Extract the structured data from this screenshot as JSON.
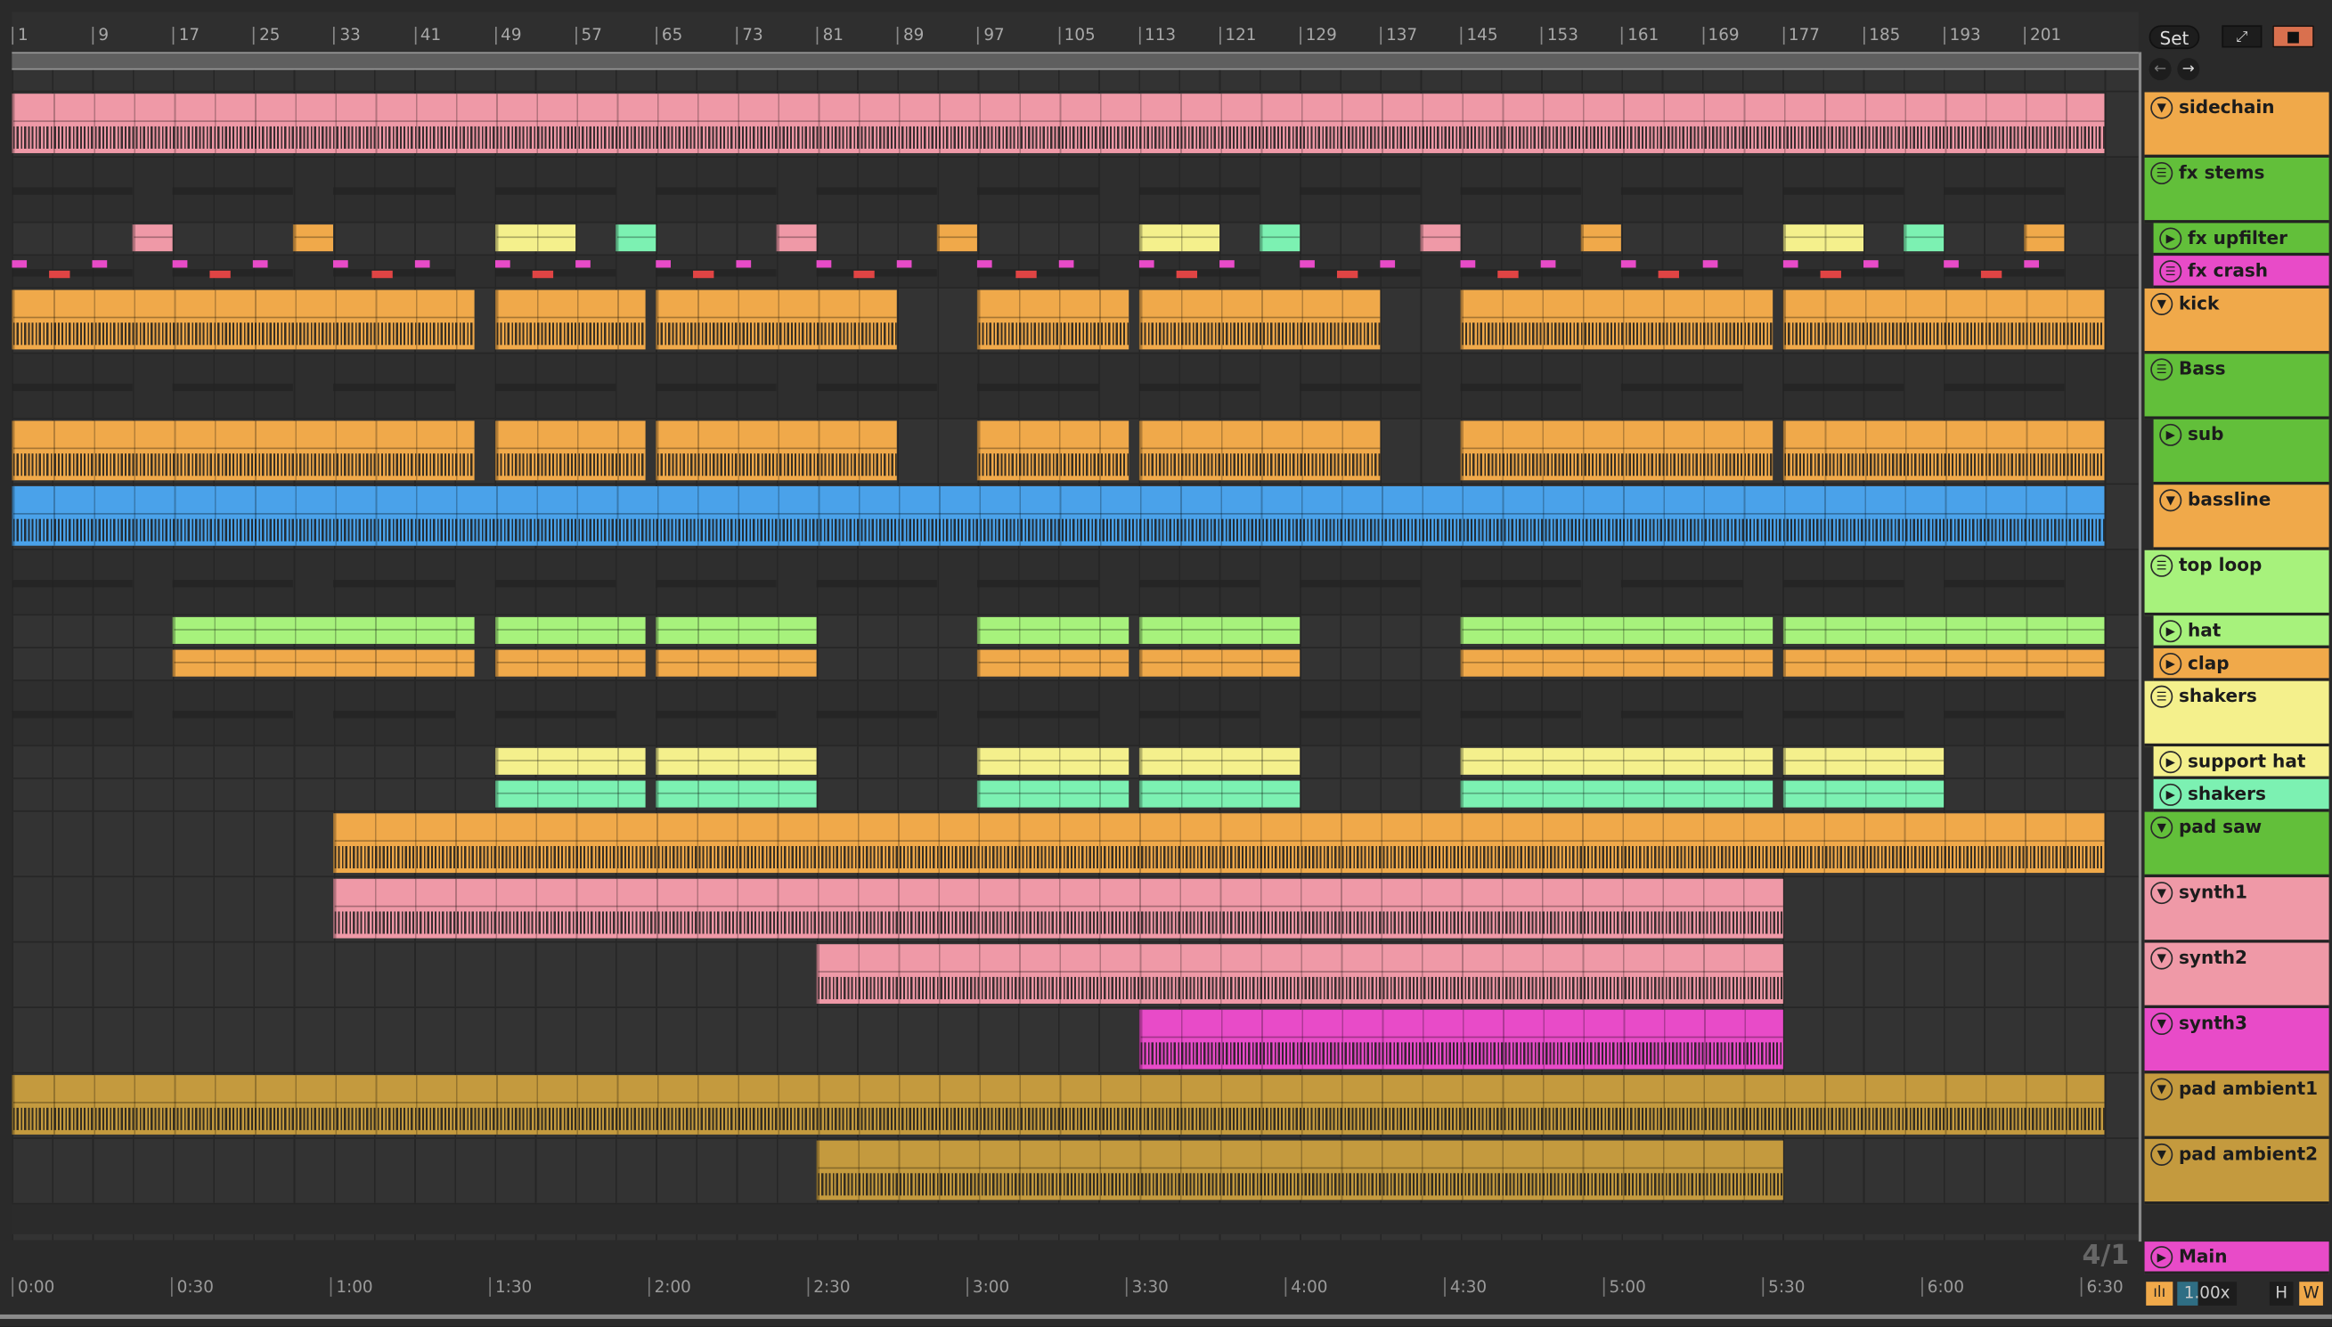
{
  "ruler": {
    "bars": [
      "1",
      "9",
      "17",
      "25",
      "33",
      "41",
      "49",
      "57",
      "65",
      "73",
      "81",
      "89",
      "97",
      "105",
      "113",
      "121",
      "129",
      "137",
      "145",
      "153",
      "161",
      "169",
      "177",
      "185",
      "193",
      "201"
    ]
  },
  "time_ruler": [
    "0:00",
    "0:30",
    "1:00",
    "1:30",
    "2:00",
    "2:30",
    "3:00",
    "3:30",
    "4:00",
    "4:30",
    "5:00",
    "5:30",
    "6:00",
    "6:30"
  ],
  "controls": {
    "set_label": "Set",
    "expand_icon": "expand-icon",
    "lock_icon": "lock-icon",
    "back_icon": "arrow-left-icon",
    "forward_icon": "arrow-right-icon",
    "time_signature": "4/1",
    "zoom_value": "1.00x",
    "h_label": "H",
    "w_label": "W"
  },
  "colors": {
    "orange": "#f0a94a",
    "green": "#62bf3a",
    "lightgreen": "#a7f27c",
    "magenta": "#e84bc8",
    "pink": "#ef99a7",
    "yellow": "#f4f08c",
    "mint": "#7cf1b2",
    "blue": "#4aa2ea",
    "gold": "#c49a3e"
  },
  "tracks": [
    {
      "name": "sidechain",
      "kind": "audio",
      "size": "tall",
      "color": "orange",
      "clips": [
        {
          "s": 1,
          "e": 209,
          "c": "pink"
        }
      ]
    },
    {
      "name": "fx stems",
      "kind": "group",
      "size": "tall",
      "color": "green",
      "clips": []
    },
    {
      "name": "fx upfilter",
      "kind": "play",
      "size": "short",
      "nested": true,
      "color": "green",
      "clips": [
        {
          "s": 13,
          "e": 17,
          "c": "pink"
        },
        {
          "s": 29,
          "e": 33,
          "c": "orange"
        },
        {
          "s": 49,
          "e": 57,
          "c": "yellow"
        },
        {
          "s": 61,
          "e": 65,
          "c": "mint"
        },
        {
          "s": 77,
          "e": 81,
          "c": "pink"
        },
        {
          "s": 93,
          "e": 97,
          "c": "orange"
        },
        {
          "s": 113,
          "e": 121,
          "c": "yellow"
        },
        {
          "s": 125,
          "e": 129,
          "c": "mint"
        },
        {
          "s": 141,
          "e": 145,
          "c": "pink"
        },
        {
          "s": 157,
          "e": 161,
          "c": "orange"
        },
        {
          "s": 177,
          "e": 185,
          "c": "yellow"
        },
        {
          "s": 189,
          "e": 193,
          "c": "mint"
        },
        {
          "s": 201,
          "e": 205,
          "c": "orange"
        }
      ]
    },
    {
      "name": "fx crash",
      "kind": "group",
      "size": "short",
      "nested": true,
      "color": "magenta",
      "clips": []
    },
    {
      "name": "kick",
      "kind": "audio",
      "size": "tall",
      "color": "orange",
      "clips": [
        {
          "s": 1,
          "e": 47,
          "c": "orange"
        },
        {
          "s": 49,
          "e": 64,
          "c": "orange"
        },
        {
          "s": 65,
          "e": 89,
          "c": "orange"
        },
        {
          "s": 97,
          "e": 112,
          "c": "orange"
        },
        {
          "s": 113,
          "e": 137,
          "c": "orange"
        },
        {
          "s": 145,
          "e": 176,
          "c": "orange"
        },
        {
          "s": 177,
          "e": 209,
          "c": "orange"
        }
      ]
    },
    {
      "name": "Bass",
      "kind": "group",
      "size": "tall",
      "color": "green",
      "clips": []
    },
    {
      "name": "sub",
      "kind": "play",
      "size": "tall",
      "nested": true,
      "color": "green",
      "clips": [
        {
          "s": 1,
          "e": 47,
          "c": "orange"
        },
        {
          "s": 49,
          "e": 64,
          "c": "orange"
        },
        {
          "s": 65,
          "e": 89,
          "c": "orange"
        },
        {
          "s": 97,
          "e": 112,
          "c": "orange"
        },
        {
          "s": 113,
          "e": 137,
          "c": "orange"
        },
        {
          "s": 145,
          "e": 176,
          "c": "orange"
        },
        {
          "s": 177,
          "e": 209,
          "c": "orange"
        }
      ]
    },
    {
      "name": "bassline",
      "kind": "audio",
      "size": "tall",
      "nested": true,
      "color": "orange",
      "clips": [
        {
          "s": 1,
          "e": 209,
          "c": "blue"
        }
      ]
    },
    {
      "name": "top loop",
      "kind": "group",
      "size": "tall",
      "color": "lightgreen",
      "clips": []
    },
    {
      "name": "hat",
      "kind": "play",
      "size": "short",
      "nested": true,
      "color": "lightgreen",
      "clips": [
        {
          "s": 17,
          "e": 47,
          "c": "lightgreen"
        },
        {
          "s": 49,
          "e": 64,
          "c": "lightgreen"
        },
        {
          "s": 65,
          "e": 81,
          "c": "lightgreen"
        },
        {
          "s": 97,
          "e": 112,
          "c": "lightgreen"
        },
        {
          "s": 113,
          "e": 129,
          "c": "lightgreen"
        },
        {
          "s": 145,
          "e": 176,
          "c": "lightgreen"
        },
        {
          "s": 177,
          "e": 209,
          "c": "lightgreen"
        }
      ]
    },
    {
      "name": "clap",
      "kind": "play",
      "size": "short",
      "nested": true,
      "color": "orange",
      "clips": [
        {
          "s": 17,
          "e": 47,
          "c": "orange"
        },
        {
          "s": 49,
          "e": 64,
          "c": "orange"
        },
        {
          "s": 65,
          "e": 81,
          "c": "orange"
        },
        {
          "s": 97,
          "e": 112,
          "c": "orange"
        },
        {
          "s": 113,
          "e": 129,
          "c": "orange"
        },
        {
          "s": 145,
          "e": 176,
          "c": "orange"
        },
        {
          "s": 177,
          "e": 209,
          "c": "orange"
        }
      ]
    },
    {
      "name": "shakers",
      "kind": "group",
      "size": "tall",
      "color": "yellow",
      "clips": []
    },
    {
      "name": "support hat",
      "kind": "play",
      "size": "short",
      "nested": true,
      "color": "yellow",
      "clips": [
        {
          "s": 49,
          "e": 64,
          "c": "yellow"
        },
        {
          "s": 65,
          "e": 81,
          "c": "yellow"
        },
        {
          "s": 97,
          "e": 112,
          "c": "yellow"
        },
        {
          "s": 113,
          "e": 129,
          "c": "yellow"
        },
        {
          "s": 145,
          "e": 176,
          "c": "yellow"
        },
        {
          "s": 177,
          "e": 193,
          "c": "yellow"
        }
      ]
    },
    {
      "name": "shakers",
      "kind": "play",
      "size": "short",
      "nested": true,
      "color": "mint",
      "clips": [
        {
          "s": 49,
          "e": 64,
          "c": "mint"
        },
        {
          "s": 65,
          "e": 81,
          "c": "mint"
        },
        {
          "s": 97,
          "e": 112,
          "c": "mint"
        },
        {
          "s": 113,
          "e": 129,
          "c": "mint"
        },
        {
          "s": 145,
          "e": 176,
          "c": "mint"
        },
        {
          "s": 177,
          "e": 193,
          "c": "mint"
        }
      ]
    },
    {
      "name": "pad saw",
      "kind": "audio",
      "size": "tall",
      "color": "green",
      "clips": [
        {
          "s": 33,
          "e": 209,
          "c": "orange"
        }
      ]
    },
    {
      "name": "synth1",
      "kind": "audio",
      "size": "tall",
      "color": "pink",
      "clips": [
        {
          "s": 33,
          "e": 177,
          "c": "pink"
        }
      ]
    },
    {
      "name": "synth2",
      "kind": "audio",
      "size": "tall",
      "color": "pink",
      "clips": [
        {
          "s": 81,
          "e": 177,
          "c": "pink"
        }
      ]
    },
    {
      "name": "synth3",
      "kind": "audio",
      "size": "tall",
      "color": "magenta",
      "clips": [
        {
          "s": 113,
          "e": 177,
          "c": "magenta"
        }
      ]
    },
    {
      "name": "pad ambient1",
      "kind": "audio",
      "size": "tall",
      "color": "gold",
      "clips": [
        {
          "s": 1,
          "e": 209,
          "c": "gold"
        }
      ]
    },
    {
      "name": "pad ambient2",
      "kind": "audio",
      "size": "tall",
      "color": "gold",
      "clips": [
        {
          "s": 81,
          "e": 177,
          "c": "gold"
        }
      ]
    }
  ],
  "main": {
    "name": "Main",
    "color": "magenta"
  }
}
